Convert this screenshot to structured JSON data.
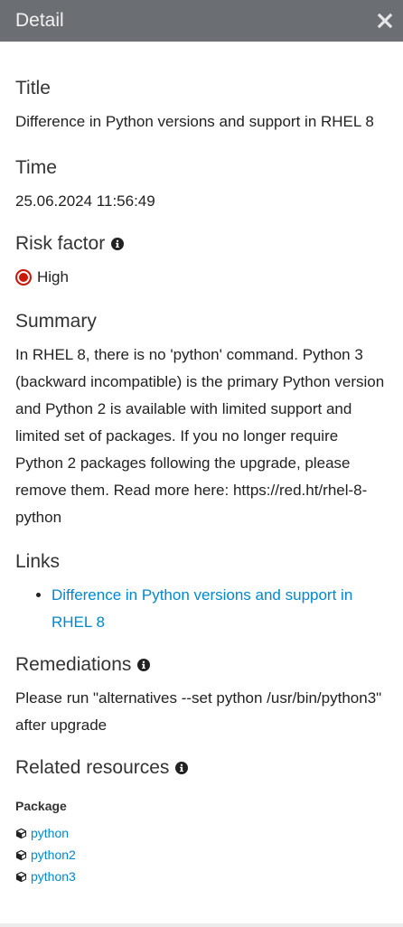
{
  "header": {
    "title": "Detail"
  },
  "sections": {
    "title": {
      "label": "Title",
      "value": "Difference in Python versions and support in RHEL 8"
    },
    "time": {
      "label": "Time",
      "value": "25.06.2024 11:56:49"
    },
    "risk": {
      "label": "Risk factor",
      "value": "High",
      "color": "#c9190b"
    },
    "summary": {
      "label": "Summary",
      "value": "In RHEL 8, there is no 'python' command. Python 3 (backward incompatible) is the primary Python version and Python 2 is available with limited support and limited set of packages. If you no longer require Python 2 packages following the upgrade, please remove them. Read more here: https://red.ht/rhel-8-python"
    },
    "links": {
      "label": "Links",
      "items": [
        "Difference in Python versions and support in RHEL 8"
      ]
    },
    "remediations": {
      "label": "Remediations",
      "value": "Please run \"alternatives --set python /usr/bin/python3\" after upgrade"
    },
    "related": {
      "label": "Related resources",
      "package_heading": "Package",
      "packages": [
        "python",
        "python2",
        "python3"
      ]
    }
  },
  "icons": {
    "close": "close-icon",
    "info": "info-icon",
    "package": "cube-icon"
  },
  "colors": {
    "header_bg": "#6b6e72",
    "link": "#0088ce",
    "risk_high": "#c9190b"
  }
}
